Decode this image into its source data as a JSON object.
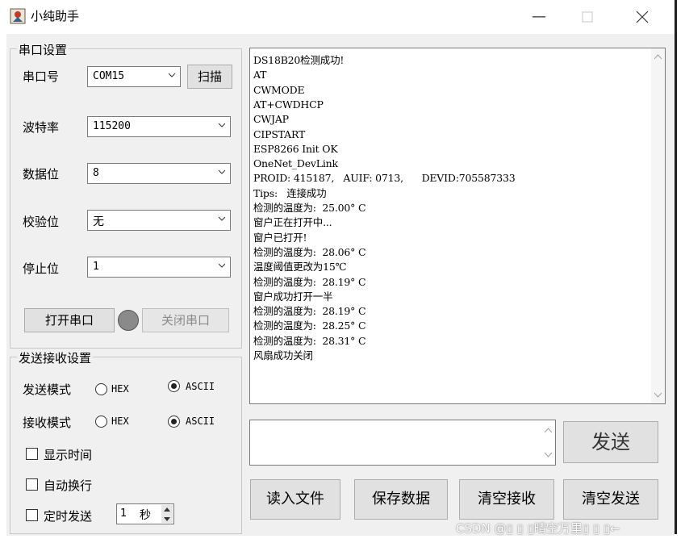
{
  "window": {
    "title": "小纯助手"
  },
  "serial": {
    "group_title": "串口设置",
    "port_label": "串口号",
    "port_value": "COM15",
    "scan_label": "扫描",
    "baud_label": "波特率",
    "baud_value": "115200",
    "databits_label": "数据位",
    "databits_value": "8",
    "parity_label": "校验位",
    "parity_value": "无",
    "stopbits_label": "停止位",
    "stopbits_value": "1",
    "open_label": "打开串口",
    "close_label": "关闭串口"
  },
  "sendrecv": {
    "group_title": "发送接收设置",
    "send_mode_label": "发送模式",
    "recv_mode_label": "接收模式",
    "hex_label": "HEX",
    "ascii_label": "ASCII",
    "show_time_label": "显示时间",
    "auto_wrap_label": "自动换行",
    "timed_send_label": "定时发送",
    "interval_value": "1",
    "interval_unit": "秒"
  },
  "receive": {
    "lines": [
      "DS18B20检测成功!",
      "AT",
      "CWMODE",
      "AT+CWDHCP",
      "CWJAP",
      "CIPSTART",
      "ESP8266 Init OK",
      "OneNet_DevLink",
      "PROID: 415187,   AUIF: 0713,      DEVID:705587333",
      "Tips:   连接成功",
      "检测的温度为:  25.00° C",
      "窗户正在打开中...",
      "窗户已打开!",
      "检测的温度为:  28.06° C",
      "温度阈值更改为15℃",
      "检测的温度为:  28.19° C",
      "窗户成功打开一半",
      "检测的温度为:  28.19° C",
      "检测的温度为:  28.25° C",
      "检测的温度为:  28.31° C",
      "风扇成功关闭"
    ]
  },
  "actions": {
    "send": "发送",
    "read_file": "读入文件",
    "save_data": "保存数据",
    "clear_recv": "清空接收",
    "clear_send": "清空发送"
  },
  "watermark": "CSDN @▯ ▯ ▯晴空万里▯ ▯ ▯←",
  "colors": {
    "client_bg": "#f0f0f0",
    "button_bg": "#e1e1e1",
    "led_off": "#8a8a8a"
  }
}
